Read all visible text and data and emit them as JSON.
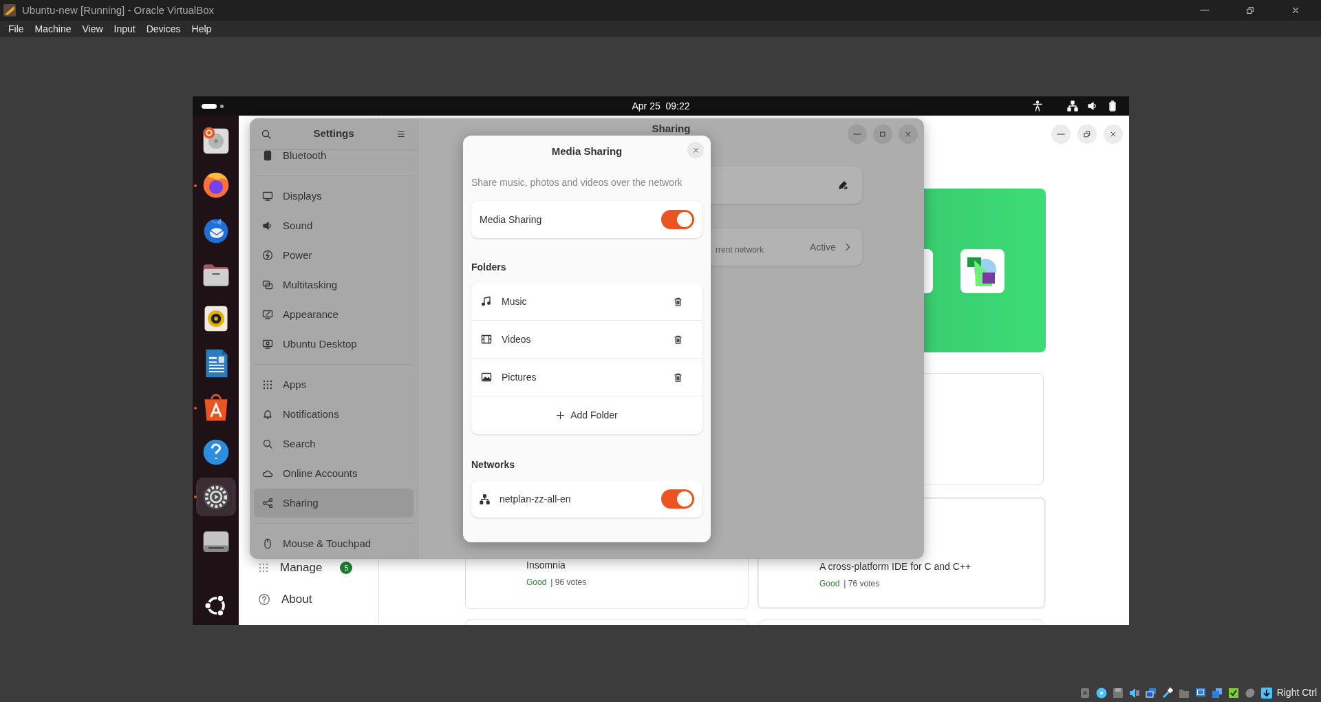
{
  "window": {
    "title": "Ubuntu-new [Running] - Oracle VirtualBox"
  },
  "menu": [
    "File",
    "Machine",
    "View",
    "Input",
    "Devices",
    "Help"
  ],
  "top_bar": {
    "clock": "Apr 25  09:22"
  },
  "dock": [
    {
      "kind": "installer",
      "running": false,
      "selected": false
    },
    {
      "kind": "browser",
      "running": true,
      "selected": false
    },
    {
      "kind": "mail",
      "running": false,
      "selected": false
    },
    {
      "kind": "files",
      "running": false,
      "selected": false
    },
    {
      "kind": "music",
      "running": false,
      "selected": false
    },
    {
      "kind": "writer",
      "running": false,
      "selected": false
    },
    {
      "kind": "store",
      "running": true,
      "selected": false
    },
    {
      "kind": "help",
      "running": false,
      "selected": false
    },
    {
      "kind": "settings",
      "running": true,
      "selected": true
    },
    {
      "kind": "drive",
      "running": false,
      "selected": false
    },
    {
      "kind": "apps",
      "running": false,
      "selected": false
    }
  ],
  "app_center": {
    "sidebar": [
      {
        "kind": "manage",
        "label": "Manage",
        "badge": "5"
      },
      {
        "kind": "about",
        "label": "About"
      }
    ],
    "cards": [
      {
        "description": "Insomnia",
        "rating": "Good",
        "votes": "| 96 votes"
      },
      {
        "description": "A cross-platform IDE for C and C++",
        "rating": "Good",
        "votes": "| 76 votes"
      }
    ]
  },
  "settings": {
    "title": "Settings",
    "page_title": "Sharing",
    "sidebar_groups": [
      [
        {
          "kind": "bluetooth",
          "label": "Bluetooth",
          "selected": false
        }
      ],
      [
        {
          "kind": "display",
          "label": "Displays",
          "selected": false
        },
        {
          "kind": "sound",
          "label": "Sound",
          "selected": false
        },
        {
          "kind": "power",
          "label": "Power",
          "selected": false
        },
        {
          "kind": "multitasking",
          "label": "Multitasking",
          "selected": false
        },
        {
          "kind": "appearance",
          "label": "Appearance",
          "selected": false
        },
        {
          "kind": "desktop",
          "label": "Ubuntu Desktop",
          "selected": false
        }
      ],
      [
        {
          "kind": "apps",
          "label": "Apps",
          "selected": false
        },
        {
          "kind": "bell",
          "label": "Notifications",
          "selected": false
        },
        {
          "kind": "search",
          "label": "Search",
          "selected": false
        },
        {
          "kind": "cloud",
          "label": "Online Accounts",
          "selected": false
        },
        {
          "kind": "share",
          "label": "Sharing",
          "selected": true
        }
      ],
      [
        {
          "kind": "mouse",
          "label": "Mouse & Touchpad",
          "selected": false
        }
      ]
    ],
    "rows": [
      {
        "kind": "edit"
      },
      {
        "kind": "link",
        "subtitle": "rrent network",
        "value": "Active"
      }
    ]
  },
  "dialog": {
    "title": "Media Sharing",
    "description": "Share music, photos and videos over the network",
    "switch": {
      "label": "Media Sharing",
      "on": true
    },
    "folders_heading": "Folders",
    "folders": [
      {
        "kind": "music",
        "label": "Music"
      },
      {
        "kind": "video",
        "label": "Videos"
      },
      {
        "kind": "picture",
        "label": "Pictures"
      }
    ],
    "add_folder": "Add Folder",
    "networks_heading": "Networks",
    "networks": [
      {
        "label": "netplan-zz-all-en",
        "on": true
      }
    ]
  },
  "status_bar": {
    "host_key": "Right Ctrl"
  }
}
